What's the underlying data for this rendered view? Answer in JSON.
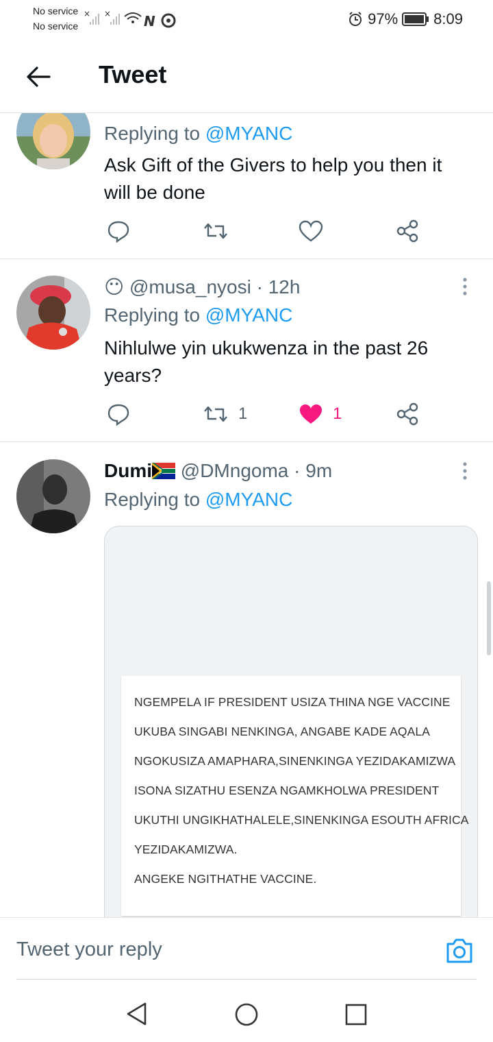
{
  "status_bar": {
    "sim1": "No service",
    "sim2": "No service",
    "battery": "97%",
    "time": "8:09",
    "icons": [
      "signal-icon",
      "wifi-icon",
      "nfc-icon",
      "chrome-icon",
      "alarm-icon",
      "battery-icon"
    ]
  },
  "header": {
    "title": "Tweet"
  },
  "tweets": [
    {
      "replying_prefix": "Replying to",
      "replying_handle": "@MYANC",
      "text_line1": "Ask Gift of the Givers to help you then it",
      "text_line2": "will be done"
    },
    {
      "emoji": "😶",
      "handle": "@musa_nyosi",
      "time": "· 12h",
      "replying_prefix": "Replying to",
      "replying_handle": "@MYANC",
      "text_line1": "Nihlulwe yin ukukwenza in the past  26",
      "text_line2": "years?",
      "retweet_count": "1",
      "like_count": "1"
    },
    {
      "display_name": "Dumi",
      "handle": "@DMngoma",
      "time": "· 9m",
      "replying_prefix": "Replying to",
      "replying_handle": "@MYANC",
      "image_text": [
        "NGEMPELA IF PRESIDENT USIZA THINA NGE VACCINE",
        "UKUBA SINGABI NENKINGA, ANGABE KADE AQALA",
        "NGOKUSIZA AMAPHARA,SINENKINGA YEZIDAKAMIZWA",
        "ISONA SIZATHU ESENZA NGAMKHOLWA PRESIDENT",
        "UKUTHI UNGIKHATHALELE,SINENKINGA ESOUTH AFRICA",
        "YEZIDAKAMIZWA.",
        "ANGEKE NGITHATHE VACCINE."
      ]
    }
  ],
  "reply_bar": {
    "placeholder": "Tweet your reply"
  },
  "colors": {
    "accent": "#1d9bf0",
    "like": "#f91880",
    "secondary_text": "#536471"
  }
}
